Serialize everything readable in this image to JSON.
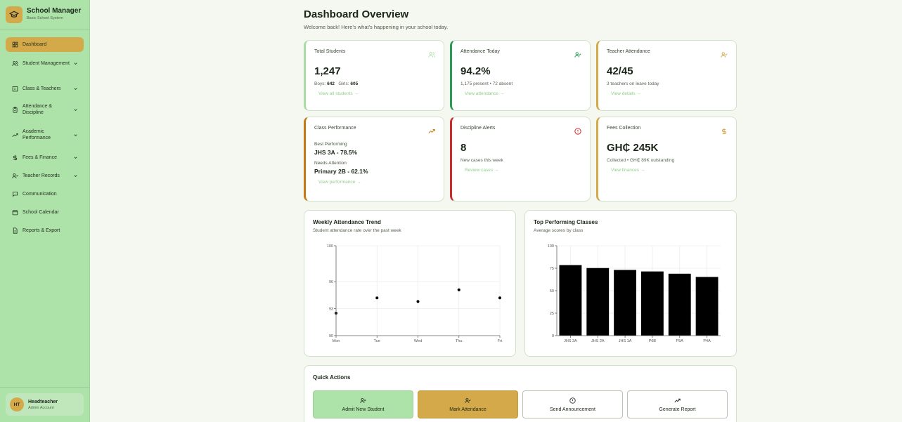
{
  "brand": {
    "name": "School Manager",
    "subtitle": "Basic School System"
  },
  "sidebar": {
    "items": [
      {
        "label": "Dashboard",
        "icon": "dashboard-icon",
        "active": true,
        "expandable": false
      },
      {
        "label": "Student Management",
        "icon": "users-icon",
        "active": false,
        "expandable": true
      },
      {
        "label": "Class & Teachers",
        "icon": "building-icon",
        "active": false,
        "expandable": true
      },
      {
        "label": "Attendance & Discipline",
        "icon": "clipboard-check-icon",
        "active": false,
        "expandable": true
      },
      {
        "label": "Academic Performance",
        "icon": "trending-up-icon",
        "active": false,
        "expandable": true
      },
      {
        "label": "Fees & Finance",
        "icon": "dollar-icon",
        "active": false,
        "expandable": true
      },
      {
        "label": "Teacher Records",
        "icon": "user-list-icon",
        "active": false,
        "expandable": true
      },
      {
        "label": "Communication",
        "icon": "message-icon",
        "active": false,
        "expandable": false
      },
      {
        "label": "School Calendar",
        "icon": "calendar-icon",
        "active": false,
        "expandable": false
      },
      {
        "label": "Reports & Export",
        "icon": "file-icon",
        "active": false,
        "expandable": false
      }
    ],
    "user": {
      "initials": "HT",
      "name": "Headteacher",
      "role": "Admin Account"
    }
  },
  "header": {
    "title": "Dashboard Overview",
    "subtitle": "Welcome back! Here's what's happening in your school today."
  },
  "stats": {
    "students": {
      "title": "Total Students",
      "value": "1,247",
      "boys_label": "Boys:",
      "boys": "642",
      "girls_label": "Girls:",
      "girls": "605",
      "link": "View all students"
    },
    "attendance": {
      "title": "Attendance Today",
      "value": "94.2%",
      "note": "1,175 present • 72 absent",
      "link": "View attendance"
    },
    "teachers": {
      "title": "Teacher Attendance",
      "value": "42/45",
      "note": "3 teachers on leave today",
      "link": "View details"
    },
    "performance": {
      "title": "Class Performance",
      "best_label": "Best Performing",
      "best": "JHS 3A - 78.5%",
      "needs_label": "Needs Attention",
      "needs": "Primary 2B - 62.1%",
      "link": "View performance"
    },
    "discipline": {
      "title": "Discipline Alerts",
      "value": "8",
      "note": "New cases this week",
      "link": "Review cases"
    },
    "fees": {
      "title": "Fees Collection",
      "value": "GH₵ 245K",
      "note": "Collected • GH₵ 89K outstanding",
      "link": "View finances"
    }
  },
  "colors": {
    "accent_green": "#ade2a9",
    "accent_gold": "#d4a94a",
    "alert_red": "#cc2a2a",
    "link_green": "#8fcf8a"
  },
  "chart_data": [
    {
      "type": "scatter",
      "title": "Weekly Attendance Trend",
      "subtitle": "Student attendance rate over the past week",
      "categories": [
        "Mon",
        "Tue",
        "Wed",
        "Thu",
        "Fri"
      ],
      "values": [
        92.5,
        94.2,
        93.8,
        95.1,
        94.2
      ],
      "ylim": [
        90,
        100
      ],
      "yticks": [
        "90",
        "93",
        "96",
        "100"
      ],
      "grid": true
    },
    {
      "type": "bar",
      "title": "Top Performing Classes",
      "subtitle": "Average scores by class",
      "categories": [
        "JHS 3A",
        "JHS 2A",
        "JHS 1A",
        "P6B",
        "P5A",
        "P4A"
      ],
      "values": [
        78.5,
        75.2,
        73.1,
        71.4,
        68.9,
        65.3
      ],
      "ylim": [
        0,
        100
      ],
      "yticks": [
        "0",
        "25",
        "50",
        "75",
        "100"
      ],
      "grid": true
    }
  ],
  "quick_actions": {
    "title": "Quick Actions",
    "buttons": [
      {
        "label": "Admit New Student",
        "icon": "user-plus-icon"
      },
      {
        "label": "Mark Attendance",
        "icon": "user-check-icon"
      },
      {
        "label": "Send Announcement",
        "icon": "alert-circle-icon"
      },
      {
        "label": "Generate Report",
        "icon": "trending-up-icon"
      }
    ]
  }
}
